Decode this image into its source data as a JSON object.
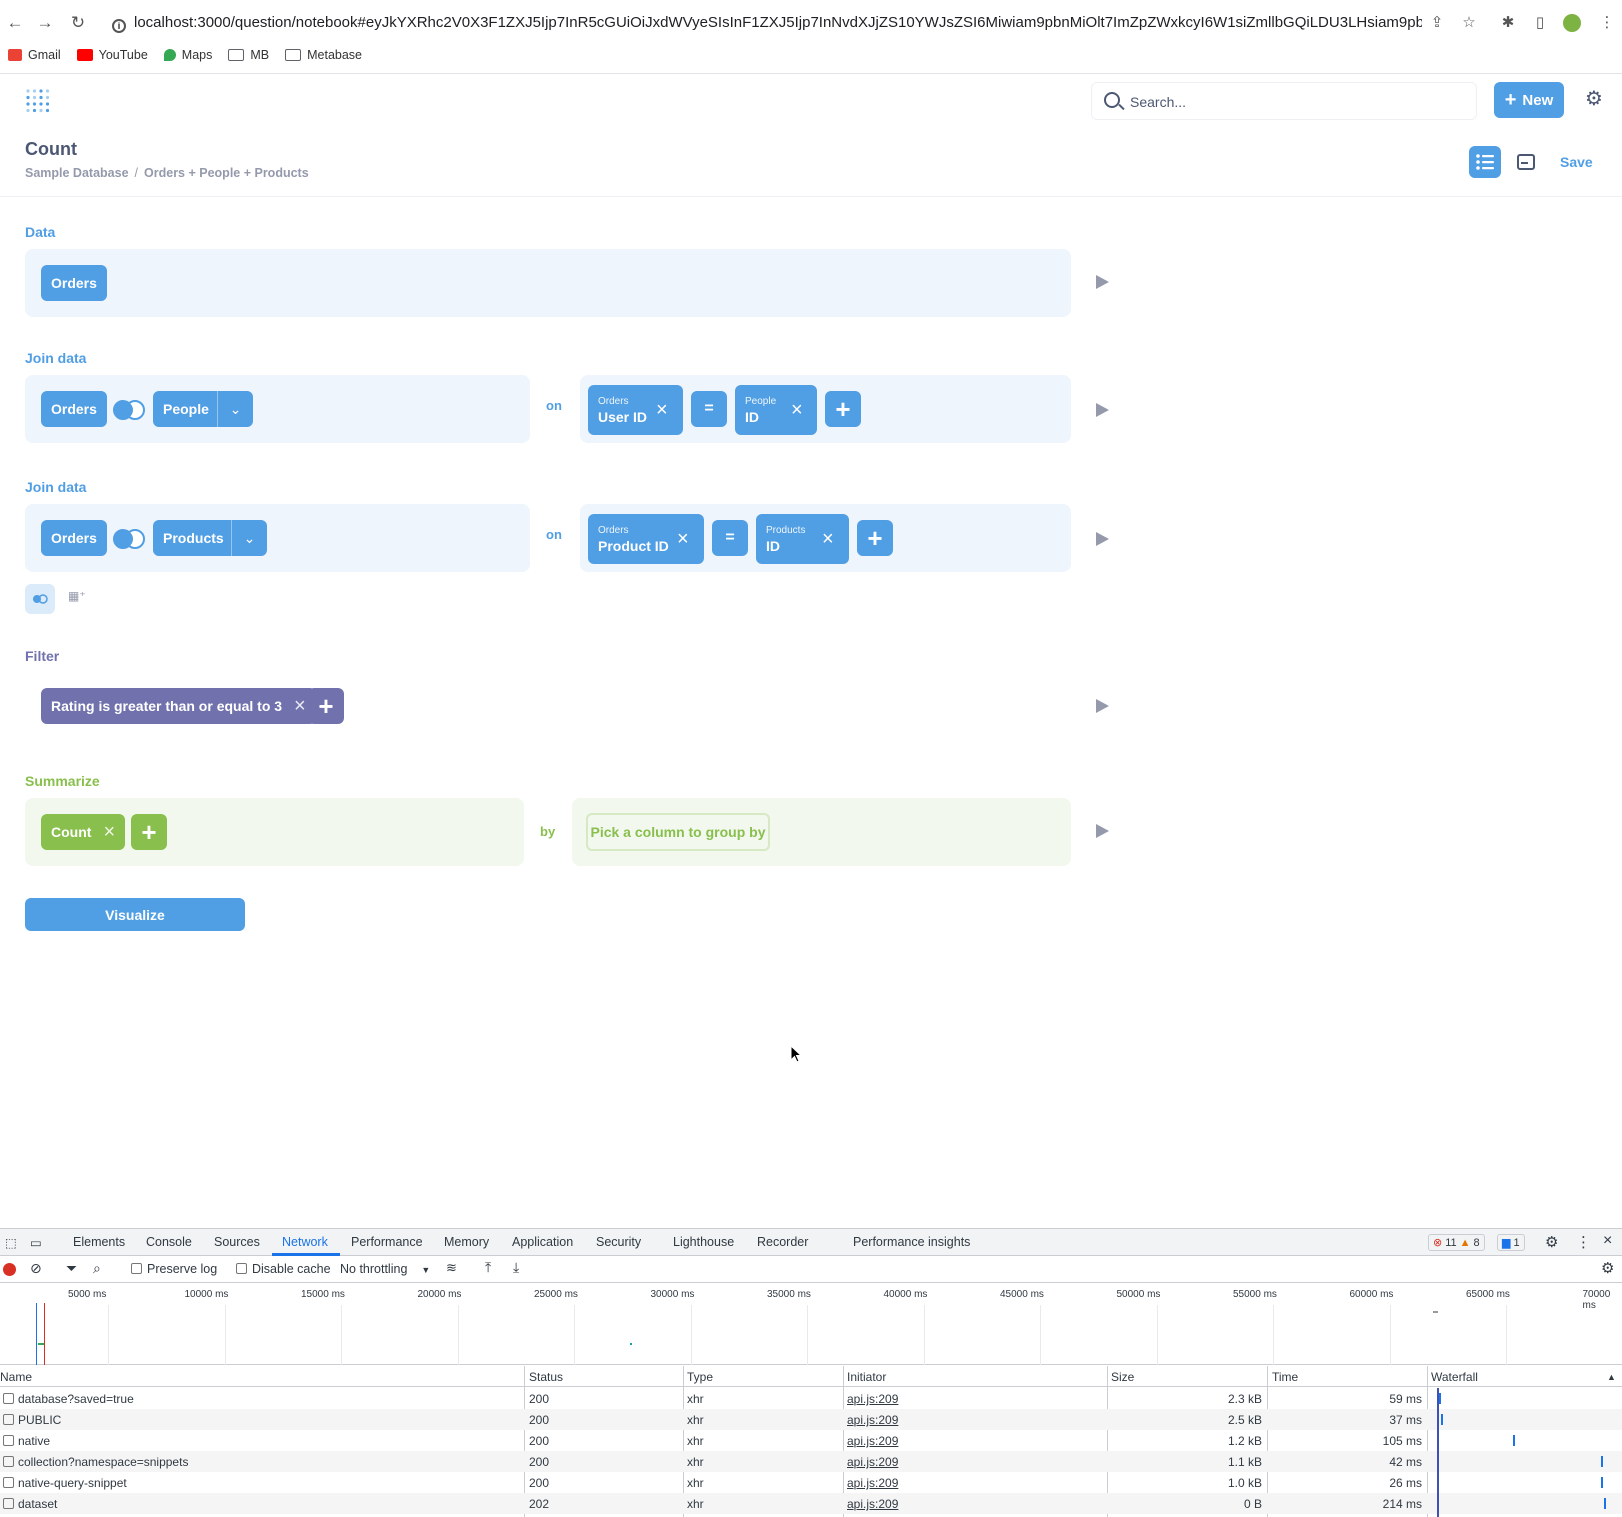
{
  "browser": {
    "url": "localhost:3000/question/notebook#eyJkYXRhc2V0X3F1ZXJ5Ijp7InR5cGUiOiJxdWVyeSIsInF1ZXJ5Ijp7InNvdXJjZS10YWJsZSI6Miwiam9pbnMiOlt7ImZpZWxkcyI6W1siZmllbGQiLDU3LHsiam9pbi1...",
    "bookmarks": [
      "Gmail",
      "YouTube",
      "Maps",
      "MB",
      "Metabase"
    ]
  },
  "header": {
    "search_placeholder": "Search...",
    "new_label": "New",
    "title": "Count",
    "breadcrumb": [
      "Sample Database",
      "/",
      "Orders + People + Products"
    ],
    "save_label": "Save"
  },
  "notebook": {
    "data": {
      "label": "Data",
      "table": "Orders"
    },
    "join1": {
      "label": "Join data",
      "left": "Orders",
      "right": "People",
      "on": "on",
      "lhs_table": "Orders",
      "lhs_col": "User ID",
      "op": "=",
      "rhs_table": "People",
      "rhs_col": "ID"
    },
    "join2": {
      "label": "Join data",
      "left": "Orders",
      "right": "Products",
      "on": "on",
      "lhs_table": "Orders",
      "lhs_col": "Product ID",
      "op": "=",
      "rhs_table": "Products",
      "rhs_col": "ID"
    },
    "filter": {
      "label": "Filter",
      "clause": "Rating is greater than or equal to 3"
    },
    "summarize": {
      "label": "Summarize",
      "metric": "Count",
      "by": "by",
      "group_placeholder": "Pick a column to group by"
    },
    "visualize_label": "Visualize"
  },
  "colors": {
    "brand": "#509ee3",
    "filter": "#7172ad",
    "summarize": "#88bf4d"
  },
  "devtools": {
    "tabs": [
      "Elements",
      "Console",
      "Sources",
      "Network",
      "Performance",
      "Memory",
      "Application",
      "Security",
      "Lighthouse",
      "Recorder",
      "Performance insights"
    ],
    "active_tab": "Network",
    "errors": "11",
    "warnings": "8",
    "messages": "1",
    "preserve_log": "Preserve log",
    "disable_cache": "Disable cache",
    "throttling": "No throttling",
    "ticks": [
      "5000 ms",
      "10000 ms",
      "15000 ms",
      "20000 ms",
      "25000 ms",
      "30000 ms",
      "35000 ms",
      "40000 ms",
      "45000 ms",
      "50000 ms",
      "55000 ms",
      "60000 ms",
      "65000 ms",
      "70000 ms"
    ],
    "columns": [
      "Name",
      "Status",
      "Type",
      "Initiator",
      "Size",
      "Time",
      "Waterfall"
    ],
    "rows": [
      {
        "name": "database?saved=true",
        "status": "200",
        "type": "xhr",
        "initiator": "api.js:209",
        "size": "2.3 kB",
        "time": "59 ms",
        "wf": 0.02
      },
      {
        "name": "PUBLIC",
        "status": "200",
        "type": "xhr",
        "initiator": "api.js:209",
        "size": "2.5 kB",
        "time": "37 ms",
        "wf": 0.03
      },
      {
        "name": "native",
        "status": "200",
        "type": "xhr",
        "initiator": "api.js:209",
        "size": "1.2 kB",
        "time": "105 ms",
        "wf": 0.45
      },
      {
        "name": "collection?namespace=snippets",
        "status": "200",
        "type": "xhr",
        "initiator": "api.js:209",
        "size": "1.1 kB",
        "time": "42 ms",
        "wf": 0.97
      },
      {
        "name": "native-query-snippet",
        "status": "200",
        "type": "xhr",
        "initiator": "api.js:209",
        "size": "1.0 kB",
        "time": "26 ms",
        "wf": 0.97
      },
      {
        "name": "dataset",
        "status": "202",
        "type": "xhr",
        "initiator": "api.js:209",
        "size": "0 B",
        "time": "214 ms",
        "wf": 0.99
      }
    ]
  }
}
